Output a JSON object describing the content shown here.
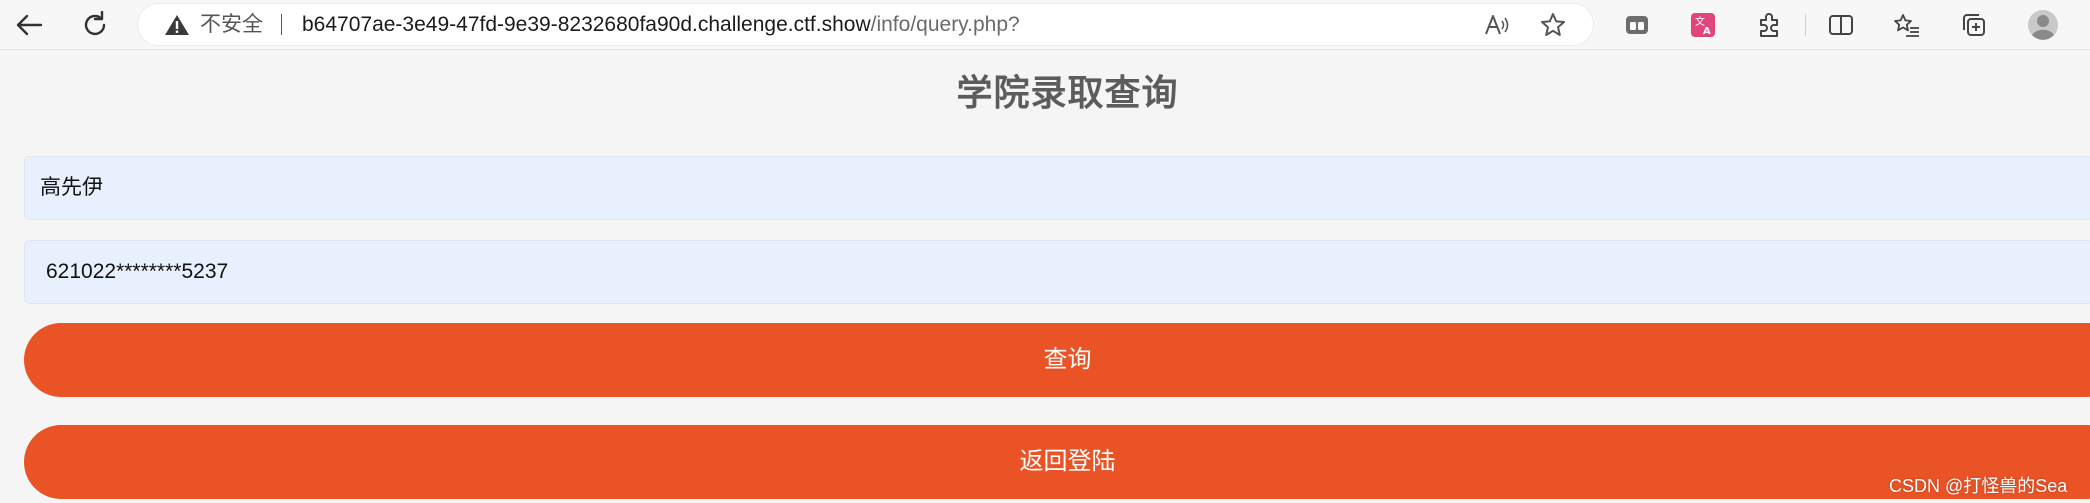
{
  "browser": {
    "security_label": "不安全",
    "url_host": "b64707ae-3e49-47fd-9e39-8232680fa90d.challenge.ctf.show",
    "url_path": "/info/query.php?",
    "icons": [
      "back-icon",
      "refresh-icon",
      "warning-icon",
      "read-aloud-icon",
      "favorite-star-icon",
      "tab-actions-icon",
      "translate-icon",
      "extensions-icon",
      "split-screen-icon",
      "favorites-icon",
      "collections-icon",
      "profile-avatar-icon"
    ]
  },
  "page": {
    "title": "学院录取查询",
    "name_value": "高先伊",
    "id_value": "621022********5237",
    "query_label": "查询",
    "back_label": "返回登陆",
    "button_color": "#ea5325",
    "input_bg_color": "#e8f0fd"
  },
  "watermark": "CSDN @打怪兽的Sea"
}
